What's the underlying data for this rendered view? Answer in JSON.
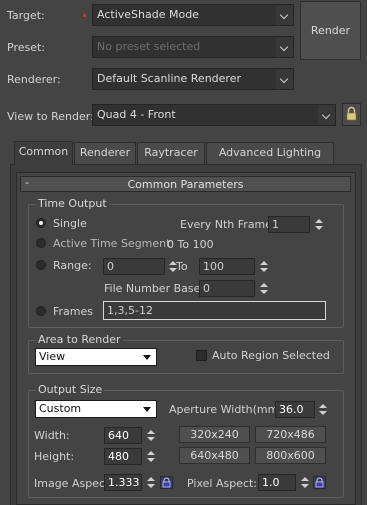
{
  "header": {
    "target_label": "Target:",
    "target_value": "ActiveShade Mode",
    "preset_label": "Preset:",
    "preset_placeholder": "No preset selected",
    "renderer_label": "Renderer:",
    "renderer_value": "Default Scanline Renderer",
    "view_label": "View to Render:",
    "view_value": "Quad 4 - Front",
    "render_button": "Render"
  },
  "tabs": [
    "Common",
    "Renderer",
    "Raytracer",
    "Advanced Lighting"
  ],
  "rollout": {
    "collapse": "-",
    "title": "Common Parameters"
  },
  "time_output": {
    "title": "Time Output",
    "single": "Single",
    "every_nth_label": "Every Nth Frame:",
    "every_nth_value": "1",
    "active_segment": "Active Time Segment:",
    "active_range": "0 To 100",
    "range": "Range:",
    "range_from": "0",
    "range_to_label": "To",
    "range_to": "100",
    "file_number_base_label": "File Number Base:",
    "file_number_base": "0",
    "frames": "Frames",
    "frames_value": "1,3,5-12"
  },
  "area": {
    "title": "Area to Render",
    "value": "View",
    "auto_region": "Auto Region Selected"
  },
  "output_size": {
    "title": "Output Size",
    "preset": "Custom",
    "aperture_label": "Aperture Width(mm):",
    "aperture_value": "36.0",
    "width_label": "Width:",
    "width_value": "640",
    "height_label": "Height:",
    "height_value": "480",
    "image_aspect_label": "Image Aspect:",
    "image_aspect_value": "1.333",
    "pixel_aspect_label": "Pixel Aspect:",
    "pixel_aspect_value": "1.0",
    "presets": [
      "320x240",
      "720x486",
      "640x480",
      "800x600"
    ]
  },
  "colors": {
    "marker_red": "#c0392b",
    "lock_blue": "#3b3fae",
    "frames_border": "#d8d8d8"
  }
}
